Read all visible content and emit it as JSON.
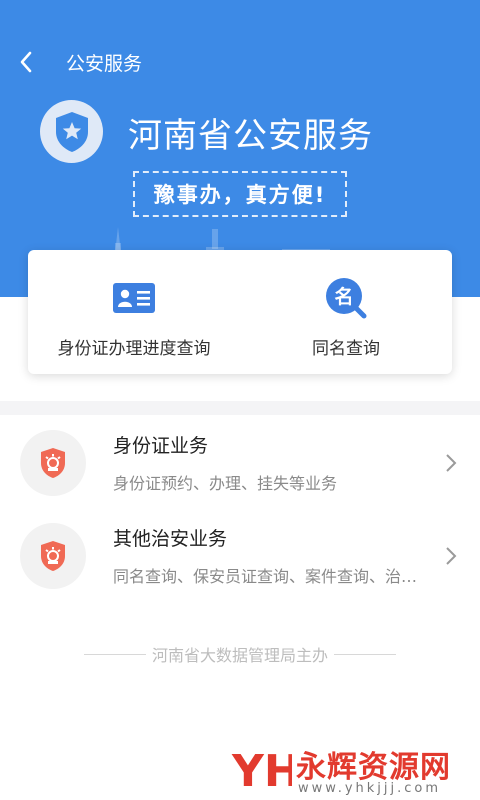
{
  "nav": {
    "back_icon": "chevron-left-icon",
    "title": "公安服务"
  },
  "hero": {
    "badge_icon": "police-shield-star-icon",
    "title": "河南省公安服务",
    "slogan": "豫事办，真方便!",
    "background_color": "#3d8ae6"
  },
  "quick_actions": [
    {
      "icon": "id-card-icon",
      "label": "身份证办理进度查询"
    },
    {
      "icon": "name-search-icon",
      "label": "同名查询",
      "icon_text": "名"
    }
  ],
  "services": [
    {
      "icon": "police-badge-icon",
      "title": "身份证业务",
      "desc": "身份证预约、办理、挂失等业务"
    },
    {
      "icon": "police-badge-icon",
      "title": "其他治安业务",
      "desc": "同名查询、保安员证查询、案件查询、治安业务"
    }
  ],
  "footer": {
    "text": "河南省大数据管理局主办"
  },
  "watermark": {
    "logo_text": "YH",
    "name": "永辉资源网",
    "url": "www.yhkjjj.com"
  },
  "colors": {
    "accent": "#3d8ae6",
    "icon_red": "#f06a55",
    "watermark_red": "#e23a2e"
  }
}
